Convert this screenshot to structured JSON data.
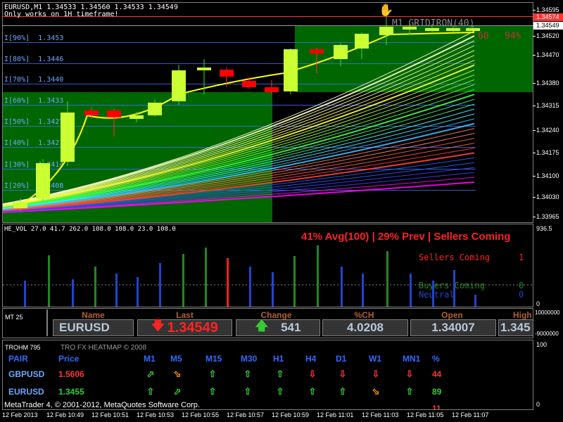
{
  "chart_header": {
    "symbol_line": "EURUSD,M1  1.34533 1.34560 1.34533 1.34549",
    "note": "Only works on 1H timeframe!",
    "indicator_label": "M1 GRIDIRON(40)",
    "indicator_value": "60",
    "indicator_pct": "94%"
  },
  "levels": [
    {
      "label": "I[90%]",
      "price": "1.3453"
    },
    {
      "label": "I[80%]",
      "price": "1.3446"
    },
    {
      "label": "I[70%]",
      "price": "1.3440"
    },
    {
      "label": "I[60%]",
      "price": "1.3433"
    },
    {
      "label": "I[50%]",
      "price": "1.3427"
    },
    {
      "label": "I[40%]",
      "price": "1.3421"
    },
    {
      "label": "I[30%]",
      "price": "1.3414"
    },
    {
      "label": "I[20%]",
      "price": "1.3408"
    }
  ],
  "price_scale": [
    "1.34595",
    "1.34574",
    "1.34549",
    "1.34520",
    "1.34470",
    "1.34380",
    "1.34315",
    "1.34240",
    "1.34175",
    "1.34100",
    "1.34030",
    "1.33965"
  ],
  "current_price_tag": "1.34549",
  "red_price_tag": "1.34574",
  "volume_pane": {
    "title": "HE_VOL 27.0 41.7 262.0 108.0 108.0 23.0 108.0",
    "headline": "41% Avg(100) | 29% Prev | Sellers Coming",
    "sellers_label": "Sellers Coming",
    "sellers_value": "1",
    "buyers_label": "Buyers Coming",
    "buyers_value": "0",
    "neutral_label": "Neutral",
    "neutral_value": "0",
    "scale_top": "936.5",
    "scale_bottom": "0"
  },
  "market_table": {
    "pane_label": "MT 25",
    "headers": [
      "Name",
      "Last",
      "Change",
      "%CH",
      "Open",
      "High"
    ],
    "name": "EURUSD",
    "last": "1.34549",
    "change": "541",
    "pct_change": "4.0208",
    "open": "1.34007",
    "high": "1.345",
    "scale_top": "10000000",
    "scale_bottom": "-9000000"
  },
  "heatmap": {
    "pane_label": "TROHM 795",
    "title": "TRO FX HEATMAP © 2008",
    "headers": [
      "PAIR",
      "Price",
      "M1",
      "M5",
      "M15",
      "M30",
      "H1",
      "H4",
      "D1",
      "W1",
      "MN1",
      "%"
    ],
    "rows": [
      {
        "pair": "GBPUSD",
        "price": "1.5606",
        "arrows": [
          "up-right",
          "down-right",
          "up",
          "up",
          "up",
          "down",
          "down",
          "down",
          "down"
        ],
        "pct": "44"
      },
      {
        "pair": "EURUSD",
        "price": "1.3455",
        "arrows": [
          "up",
          "up-right",
          "up",
          "up",
          "up",
          "up",
          "up",
          "down-right",
          "up"
        ],
        "pct": "89"
      }
    ],
    "third_row_pct": "11",
    "scale_top": "100",
    "scale_bottom": "0"
  },
  "copyright": "MetaTrader 4, © 2001-2012, MetaQuotes Software Corp.",
  "time_axis": [
    "12 Feb 2013",
    "12 Feb 10:49",
    "12 Feb 10:51",
    "12 Feb 10:53",
    "12 Feb 10:55",
    "12 Feb 10:57",
    "12 Feb 10:59",
    "12 Feb 11:01",
    "12 Feb 11:03",
    "12 Feb 11:05",
    "12 Feb 11:07"
  ],
  "colors": {
    "bull_candle": "#ccff33",
    "bear_candle": "#ff0000",
    "zone_green": "#006600",
    "level_blue": "#3f6fff",
    "up_arrow": "#33cc33",
    "down_arrow": "#ff3333",
    "orange_arrow": "#ff9900"
  }
}
